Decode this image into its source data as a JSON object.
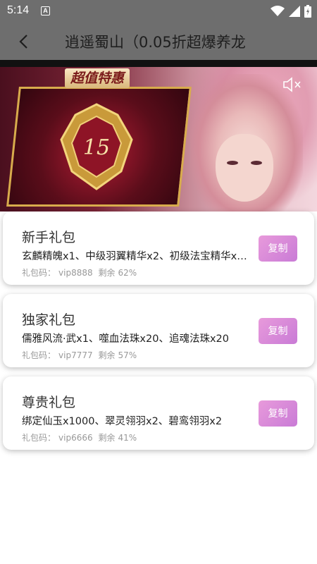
{
  "status_bar": {
    "time": "5:14",
    "notification_letter": "A"
  },
  "header": {
    "title": "逍遥蜀山（0.05折超爆养龙"
  },
  "banner": {
    "tag_text": "超值特惠",
    "emblem_number": "15"
  },
  "gifts": [
    {
      "title": "新手礼包",
      "items": "玄麟精魄x1、中级羽翼精华x2、初级法宝精华x…",
      "code_label": "礼包码：",
      "code": "vip8888",
      "remain_label": "剩余",
      "remain": "62%",
      "copy_label": "复制"
    },
    {
      "title": "独家礼包",
      "items": "儒雅风流·武x1、噬血法珠x20、追魂法珠x20",
      "code_label": "礼包码：",
      "code": "vip7777",
      "remain_label": "剩余",
      "remain": "57%",
      "copy_label": "复制"
    },
    {
      "title": "尊贵礼包",
      "items": "绑定仙玉x1000、翠灵翎羽x2、碧鸾翎羽x2",
      "code_label": "礼包码：",
      "code": "vip6666",
      "remain_label": "剩余",
      "remain": "41%",
      "copy_label": "复制"
    }
  ],
  "colors": {
    "status_bar": "#6e6e6e",
    "copy_button": "#d98cd8",
    "card_bg": "#ffffff"
  },
  "icons": [
    "wifi-icon",
    "signal-icon",
    "battery-icon",
    "back-arrow-icon",
    "mute-icon"
  ]
}
